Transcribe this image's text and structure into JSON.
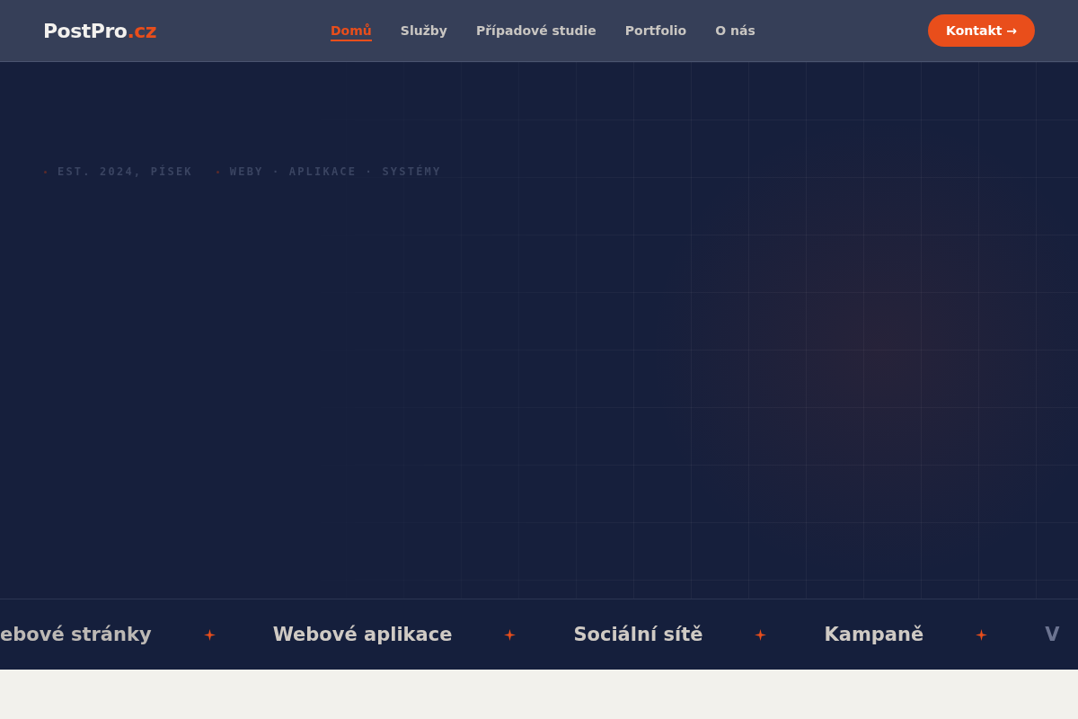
{
  "header": {
    "logo": {
      "name": "PostPro",
      "suffix": ".cz"
    },
    "nav": [
      {
        "label": "Domů",
        "selected": true
      },
      {
        "label": "Služby",
        "selected": false
      },
      {
        "label": "Případové studie",
        "selected": false
      },
      {
        "label": "Portfolio",
        "selected": false
      },
      {
        "label": "O nás",
        "selected": false
      }
    ],
    "cta": "Kontakt →"
  },
  "hero": {
    "tagline": [
      "EST. 2024, PÍSEK",
      "WEBY · APLIKACE · SYSTÉMY"
    ]
  },
  "marquee": [
    {
      "label": "ebové stránky",
      "faded": false
    },
    {
      "label": "Webové aplikace",
      "faded": false
    },
    {
      "label": "Sociální sítě",
      "faded": false
    },
    {
      "label": "Kampaně",
      "faded": false
    },
    {
      "label": "V",
      "faded": true
    }
  ]
}
